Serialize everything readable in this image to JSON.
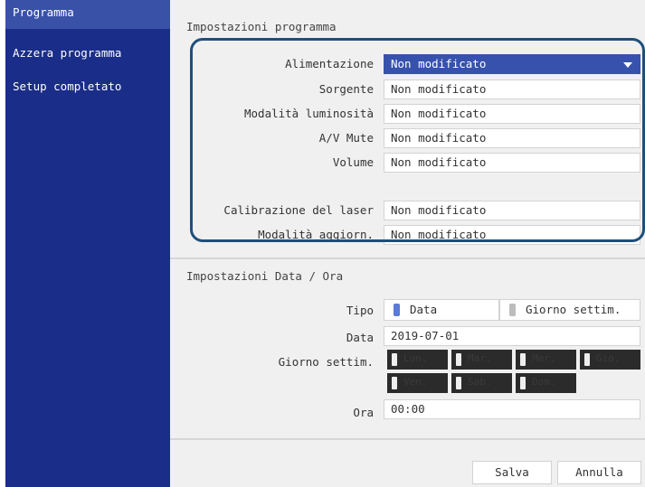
{
  "sidebar": {
    "items": [
      {
        "label": "Programma"
      },
      {
        "label": "Azzera programma"
      },
      {
        "label": "Setup completato"
      }
    ]
  },
  "program_settings": {
    "title": "Impostazioni programma",
    "rows": [
      {
        "label": "Alimentazione",
        "value": "Non modificato"
      },
      {
        "label": "Sorgente",
        "value": "Non modificato"
      },
      {
        "label": "Modalità luminosità",
        "value": "Non modificato"
      },
      {
        "label": "A/V Mute",
        "value": "Non modificato"
      },
      {
        "label": "Volume",
        "value": "Non modificato"
      },
      {
        "label": "Calibrazione del laser",
        "value": "Non modificato"
      },
      {
        "label": "Modalità aggiorn.",
        "value": "Non modificato"
      }
    ]
  },
  "datetime_settings": {
    "title": "Impostazioni Data / Ora",
    "type_label": "Tipo",
    "type_options": [
      {
        "label": "Data",
        "selected": true
      },
      {
        "label": "Giorno settim.",
        "selected": false
      }
    ],
    "date_label": "Data",
    "date_value": "2019-07-01",
    "weekday_label": "Giorno settim.",
    "weekdays": [
      "Lun.",
      "Mar.",
      "Mer.",
      "Gio.",
      "Ven.",
      "Sab.",
      "Dom."
    ],
    "time_label": "Ora",
    "time_value": "00:00"
  },
  "buttons": {
    "save": "Salva",
    "cancel": "Annulla"
  },
  "colors": {
    "sidebar": "#1a2d88",
    "sidebar_active": "#3a51a8",
    "selected_field": "#3752ad",
    "highlight_border": "#1f4f7a",
    "radio_selected": "#5a7bd6",
    "radio_unselected": "#bdbdbd"
  }
}
